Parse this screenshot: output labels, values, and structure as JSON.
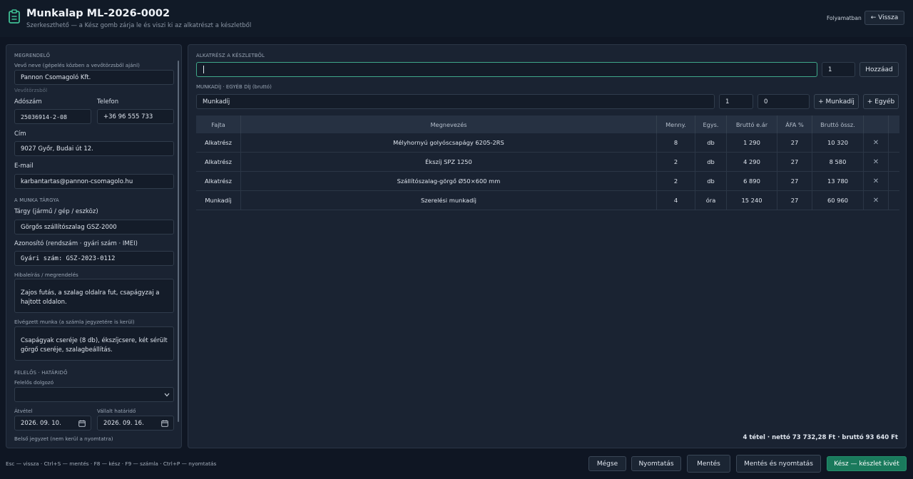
{
  "header": {
    "title": "Munkalap ML-2026-0002",
    "subtitle": "Szerkeszthető — a Kész gomb zárja le és viszi ki az alkatrészt a készletből",
    "status": "Folyamatban",
    "back_label": "← Vissza",
    "icon": "clipboard-icon"
  },
  "customer": {
    "section": "MEGRENDELŐ",
    "name_label": "Vevő neve (gépelés közben a vevőtörzsből ajánl)",
    "name_value": "Pannon Csomagoló Kft.",
    "hint": "Vevőtörzsből",
    "tax_label": "Adószám",
    "tax_value": "25036914-2-08",
    "phone_label": "Telefon",
    "phone_value": "+36 96 555 733",
    "address_label": "Cím",
    "address_value": "9027 Győr, Budai út 12.",
    "email_label": "E-mail",
    "email_value": "karbantartas@pannon-csomagolo.hu"
  },
  "subject": {
    "section": "A MUNKA TÁRGYA",
    "object_label": "Tárgy (jármű / gép / eszköz)",
    "object_value": "Görgős szállítószalag GSZ-2000",
    "id_label": "Azonosító (rendszám · gyári szám · IMEI)",
    "id_value": "Gyári szám: GSZ-2023-0112",
    "fault_label": "Hibaleírás / megrendelés",
    "fault_value": "Zajos futás, a szalag oldalra fut, csapágyzaj a hajtott oldalon.",
    "work_label": "Elvégzett munka (a számla jegyzetére is kerül)",
    "work_value": "Csapágyak cseréje (8 db), ékszíjcsere, két sérült görgő cseréje, szalagbeállítás."
  },
  "responsible": {
    "section": "FELELŐS · HATÁRIDŐ",
    "worker_label": "Felelős dolgozó",
    "worker_value": "",
    "received_label": "Átvétel",
    "received_value": "2026. 09. 10.",
    "deadline_label": "Vállalt határidő",
    "deadline_value": "2026. 09. 16.",
    "note_label": "Belső jegyzet (nem kerül a nyomtatra)"
  },
  "parts": {
    "section": "ALKATRÉSZ A KÉSZLETBŐL",
    "search_value": "",
    "qty_value": "1",
    "add_label": "Hozzáad"
  },
  "labor": {
    "section": "MUNKADÍJ · EGYÉB DÍJ (bruttó)",
    "name_value": "Munkadíj",
    "qty_value": "1",
    "price_value": "0",
    "add_labor_label": "+ Munkadíj",
    "add_other_label": "+ Egyéb"
  },
  "table": {
    "headers": [
      "Fajta",
      "Megnevezés",
      "Menny.",
      "Egys.",
      "Bruttó e.ár",
      "ÁFA %",
      "Bruttó össz."
    ],
    "rows": [
      [
        "Alkatrész",
        "Mélyhornyú golyóscsapágy 6205-2RS",
        "8",
        "db",
        "1 290",
        "27",
        "10 320"
      ],
      [
        "Alkatrész",
        "Ékszíj SPZ 1250",
        "2",
        "db",
        "4 290",
        "27",
        "8 580"
      ],
      [
        "Alkatrész",
        "Szállítószalag-görgő Ø50×600 mm",
        "2",
        "db",
        "6 890",
        "27",
        "13 780"
      ],
      [
        "Munkadíj",
        "Szerelési munkadíj",
        "4",
        "óra",
        "15 240",
        "27",
        "60 960"
      ]
    ],
    "delete_symbol": "✕"
  },
  "summary": "4 tétel · nettó 73 732,28 Ft · bruttó 93 640 Ft",
  "footer": {
    "shortcuts": "Esc — vissza · Ctrl+S — mentés · F8 — kész · F9 — számla · Ctrl+P — nyomtatás",
    "cancel": "Mégse",
    "print": "Nyomtatás",
    "save": "Mentés",
    "save_print": "Mentés és nyomtatás",
    "done": "Kész — készlet kivét"
  },
  "colors": {
    "accent": "#1a7a5c",
    "focus": "#3fa88a",
    "background": "#0f1623",
    "panel": "#1a2332"
  }
}
